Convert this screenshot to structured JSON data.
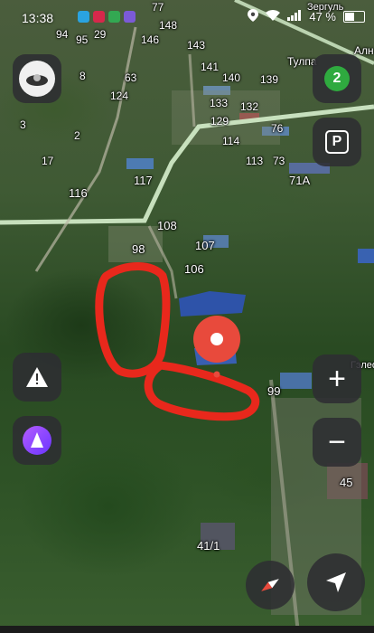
{
  "status_bar": {
    "time": "13:38",
    "battery": "47 %"
  },
  "map": {
    "place_labels": {
      "village": "Тулпа",
      "village_edge": "Алн",
      "street_top": "Зергуль",
      "street_right": "Гэлео"
    },
    "house_numbers": [
      "94",
      "95",
      "29",
      "146",
      "148",
      "77",
      "143",
      "141",
      "8",
      "63",
      "140",
      "139",
      "124",
      "133",
      "132",
      "3",
      "129",
      "76",
      "2",
      "114",
      "17",
      "113",
      "73",
      "116",
      "117",
      "71А",
      "108",
      "107",
      "98",
      "106",
      "99",
      "45",
      "41/1"
    ],
    "route_color": "#cfe8c5",
    "marker_color": "#e84a3c",
    "drawing_color": "#e8281c"
  },
  "controls": {
    "traffic_level": "2",
    "parking_label": "P",
    "zoom_in": "+",
    "zoom_out": "−"
  }
}
